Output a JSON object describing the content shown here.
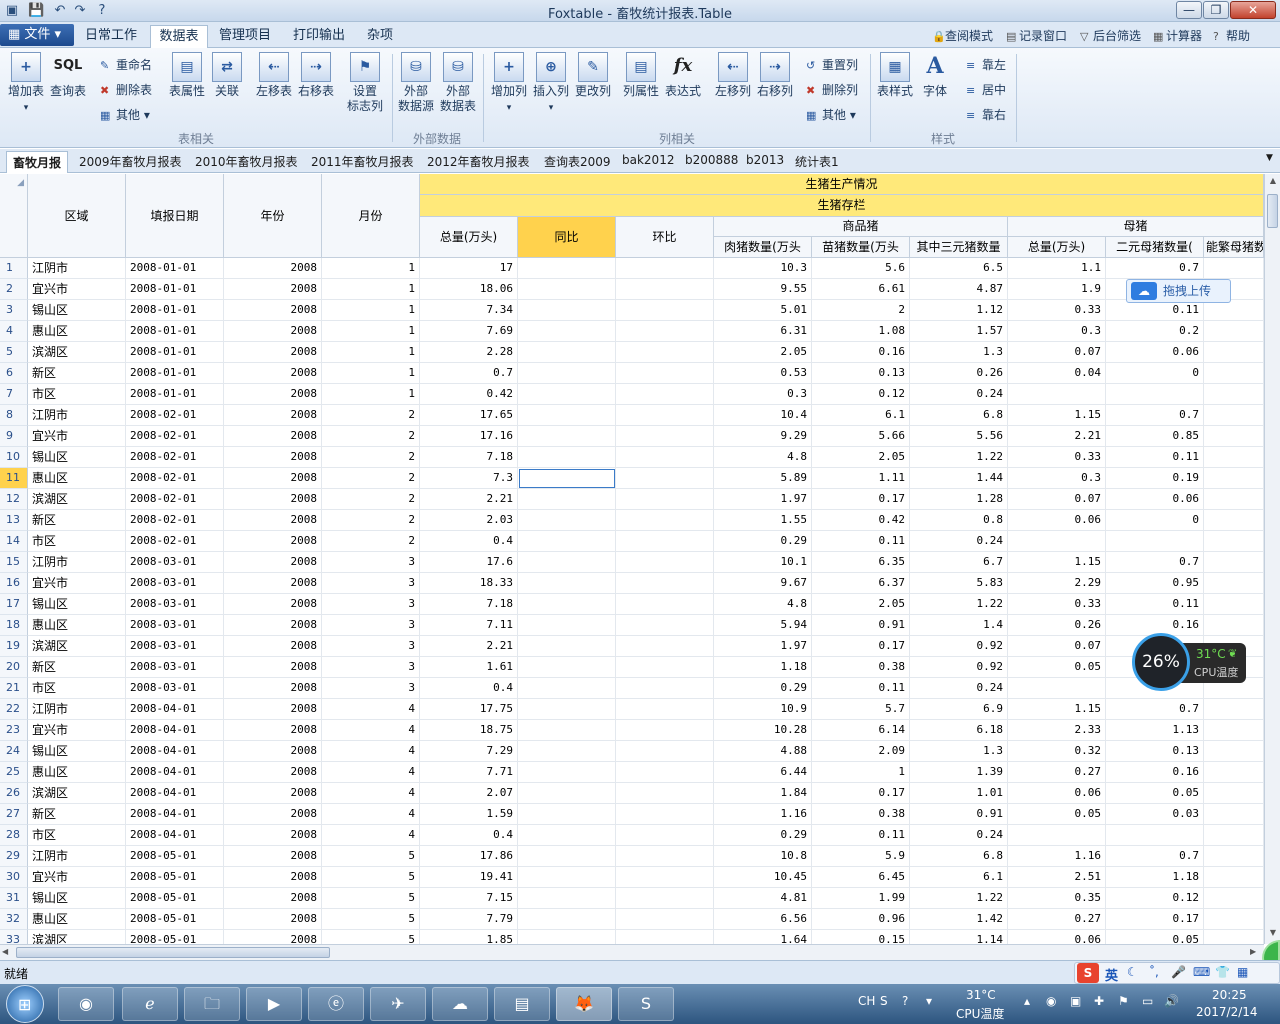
{
  "window": {
    "title": "Foxtable - 畜牧统计报表.Table",
    "min_label": "—",
    "max_label": "❐",
    "close_label": "✕"
  },
  "menu": {
    "file_label": "▦ 文件 ▾",
    "tabs": [
      "日常工作",
      "数据表",
      "管理项目",
      "打印输出",
      "杂项"
    ],
    "right_tools": [
      "查阅模式",
      "记录窗口",
      "后台筛选",
      "计算器",
      "帮助"
    ]
  },
  "ribbon": {
    "table_group": {
      "label": "表相关",
      "add_table": "增加表",
      "query_table": "查询表",
      "rename": "重命名",
      "delete_table": "删除表",
      "other": "其他",
      "table_props": "表属性",
      "relation": "关联",
      "move_left": "左移表",
      "move_right": "右移表",
      "set_flag_col_1": "设置",
      "set_flag_col_2": "标志列"
    },
    "external_group": {
      "label": "外部数据",
      "ext_source_1": "外部",
      "ext_source_2": "数据源",
      "ext_table_1": "外部",
      "ext_table_2": "数据表"
    },
    "column_group": {
      "label": "列相关",
      "add_col": "增加列",
      "insert_col": "插入列",
      "change_col": "更改列",
      "col_props": "列属性",
      "expression": "表达式",
      "col_left": "左移列",
      "col_right": "右移列",
      "reset_cols": "重置列",
      "delete_col": "删除列",
      "other": "其他"
    },
    "style_group": {
      "label": "样式",
      "table_style": "表样式",
      "font": "字体",
      "align_left": "靠左",
      "align_center": "居中",
      "align_right": "靠右"
    }
  },
  "sheet_tabs": [
    "畜牧月报",
    "2009年畜牧月报表",
    "2010年畜牧月报表",
    "2011年畜牧月报表",
    "2012年畜牧月报表",
    "查询表2009",
    "bak2012",
    "b200888",
    "b2013",
    "统计表1"
  ],
  "grid_headers": {
    "region": "区域",
    "report_date": "填报日期",
    "year": "年份",
    "month": "月份",
    "band1": "生猪生产情况",
    "band2": "生猪存栏",
    "total": "总量(万头)",
    "yoy": "同比",
    "mom": "环比",
    "commodity_pig": "商品猪",
    "meat_pig": "肉猪数量(万头",
    "piglet": "苗猪数量(万头",
    "three_cross": "其中三元猪数量",
    "sow": "母猪",
    "sow_total": "总量(万头)",
    "two_cross_sow": "二元母猪数量(",
    "breeding_sow": "能繁母猪数"
  },
  "rows": [
    [
      "1",
      "江阴市",
      "2008-01-01",
      "2008",
      "1",
      "17",
      "",
      "",
      "10.3",
      "5.6",
      "6.5",
      "1.1",
      "0.7"
    ],
    [
      "2",
      "宜兴市",
      "2008-01-01",
      "2008",
      "1",
      "18.06",
      "",
      "",
      "9.55",
      "6.61",
      "4.87",
      "1.9",
      ""
    ],
    [
      "3",
      "锡山区",
      "2008-01-01",
      "2008",
      "1",
      "7.34",
      "",
      "",
      "5.01",
      "2",
      "1.12",
      "0.33",
      "0.11"
    ],
    [
      "4",
      "惠山区",
      "2008-01-01",
      "2008",
      "1",
      "7.69",
      "",
      "",
      "6.31",
      "1.08",
      "1.57",
      "0.3",
      "0.2"
    ],
    [
      "5",
      "滨湖区",
      "2008-01-01",
      "2008",
      "1",
      "2.28",
      "",
      "",
      "2.05",
      "0.16",
      "1.3",
      "0.07",
      "0.06"
    ],
    [
      "6",
      "新区",
      "2008-01-01",
      "2008",
      "1",
      "0.7",
      "",
      "",
      "0.53",
      "0.13",
      "0.26",
      "0.04",
      "0"
    ],
    [
      "7",
      "市区",
      "2008-01-01",
      "2008",
      "1",
      "0.42",
      "",
      "",
      "0.3",
      "0.12",
      "0.24",
      "",
      ""
    ],
    [
      "8",
      "江阴市",
      "2008-02-01",
      "2008",
      "2",
      "17.65",
      "",
      "",
      "10.4",
      "6.1",
      "6.8",
      "1.15",
      "0.7"
    ],
    [
      "9",
      "宜兴市",
      "2008-02-01",
      "2008",
      "2",
      "17.16",
      "",
      "",
      "9.29",
      "5.66",
      "5.56",
      "2.21",
      "0.85"
    ],
    [
      "10",
      "锡山区",
      "2008-02-01",
      "2008",
      "2",
      "7.18",
      "",
      "",
      "4.8",
      "2.05",
      "1.22",
      "0.33",
      "0.11"
    ],
    [
      "11",
      "惠山区",
      "2008-02-01",
      "2008",
      "2",
      "7.3",
      "",
      "",
      "5.89",
      "1.11",
      "1.44",
      "0.3",
      "0.19"
    ],
    [
      "12",
      "滨湖区",
      "2008-02-01",
      "2008",
      "2",
      "2.21",
      "",
      "",
      "1.97",
      "0.17",
      "1.28",
      "0.07",
      "0.06"
    ],
    [
      "13",
      "新区",
      "2008-02-01",
      "2008",
      "2",
      "2.03",
      "",
      "",
      "1.55",
      "0.42",
      "0.8",
      "0.06",
      "0"
    ],
    [
      "14",
      "市区",
      "2008-02-01",
      "2008",
      "2",
      "0.4",
      "",
      "",
      "0.29",
      "0.11",
      "0.24",
      "",
      ""
    ],
    [
      "15",
      "江阴市",
      "2008-03-01",
      "2008",
      "3",
      "17.6",
      "",
      "",
      "10.1",
      "6.35",
      "6.7",
      "1.15",
      "0.7"
    ],
    [
      "16",
      "宜兴市",
      "2008-03-01",
      "2008",
      "3",
      "18.33",
      "",
      "",
      "9.67",
      "6.37",
      "5.83",
      "2.29",
      "0.95"
    ],
    [
      "17",
      "锡山区",
      "2008-03-01",
      "2008",
      "3",
      "7.18",
      "",
      "",
      "4.8",
      "2.05",
      "1.22",
      "0.33",
      "0.11"
    ],
    [
      "18",
      "惠山区",
      "2008-03-01",
      "2008",
      "3",
      "7.11",
      "",
      "",
      "5.94",
      "0.91",
      "1.4",
      "0.26",
      "0.16"
    ],
    [
      "19",
      "滨湖区",
      "2008-03-01",
      "2008",
      "3",
      "2.21",
      "",
      "",
      "1.97",
      "0.17",
      "0.92",
      "0.07",
      ""
    ],
    [
      "20",
      "新区",
      "2008-03-01",
      "2008",
      "3",
      "1.61",
      "",
      "",
      "1.18",
      "0.38",
      "0.92",
      "0.05",
      ""
    ],
    [
      "21",
      "市区",
      "2008-03-01",
      "2008",
      "3",
      "0.4",
      "",
      "",
      "0.29",
      "0.11",
      "0.24",
      "",
      ""
    ],
    [
      "22",
      "江阴市",
      "2008-04-01",
      "2008",
      "4",
      "17.75",
      "",
      "",
      "10.9",
      "5.7",
      "6.9",
      "1.15",
      "0.7"
    ],
    [
      "23",
      "宜兴市",
      "2008-04-01",
      "2008",
      "4",
      "18.75",
      "",
      "",
      "10.28",
      "6.14",
      "6.18",
      "2.33",
      "1.13"
    ],
    [
      "24",
      "锡山区",
      "2008-04-01",
      "2008",
      "4",
      "7.29",
      "",
      "",
      "4.88",
      "2.09",
      "1.3",
      "0.32",
      "0.13"
    ],
    [
      "25",
      "惠山区",
      "2008-04-01",
      "2008",
      "4",
      "7.71",
      "",
      "",
      "6.44",
      "1",
      "1.39",
      "0.27",
      "0.16"
    ],
    [
      "26",
      "滨湖区",
      "2008-04-01",
      "2008",
      "4",
      "2.07",
      "",
      "",
      "1.84",
      "0.17",
      "1.01",
      "0.06",
      "0.05"
    ],
    [
      "27",
      "新区",
      "2008-04-01",
      "2008",
      "4",
      "1.59",
      "",
      "",
      "1.16",
      "0.38",
      "0.91",
      "0.05",
      "0.03"
    ],
    [
      "28",
      "市区",
      "2008-04-01",
      "2008",
      "4",
      "0.4",
      "",
      "",
      "0.29",
      "0.11",
      "0.24",
      "",
      ""
    ],
    [
      "29",
      "江阴市",
      "2008-05-01",
      "2008",
      "5",
      "17.86",
      "",
      "",
      "10.8",
      "5.9",
      "6.8",
      "1.16",
      "0.7"
    ],
    [
      "30",
      "宜兴市",
      "2008-05-01",
      "2008",
      "5",
      "19.41",
      "",
      "",
      "10.45",
      "6.45",
      "6.1",
      "2.51",
      "1.18"
    ],
    [
      "31",
      "锡山区",
      "2008-05-01",
      "2008",
      "5",
      "7.15",
      "",
      "",
      "4.81",
      "1.99",
      "1.22",
      "0.35",
      "0.12"
    ],
    [
      "32",
      "惠山区",
      "2008-05-01",
      "2008",
      "5",
      "7.79",
      "",
      "",
      "6.56",
      "0.96",
      "1.42",
      "0.27",
      "0.17"
    ],
    [
      "33",
      "滨湖区",
      "2008-05-01",
      "2008",
      "5",
      "1.85",
      "",
      "",
      "1.64",
      "0.15",
      "1.14",
      "0.06",
      "0.05"
    ]
  ],
  "overlay": {
    "upload_label": "拖拽上传",
    "cpu_percent": "26%",
    "cpu_temp": "31°C",
    "cpu_label": "CPU温度"
  },
  "status": {
    "text": "就绪",
    "ime_label": "英"
  },
  "taskbar": {
    "tray_lang": "CH",
    "tray_temp": "31°C",
    "tray_temp_label": "CPU温度",
    "time": "20:25",
    "date": "2017/2/14"
  },
  "colors": {
    "band_yellow": "#ffe97a",
    "selected_header": "#ffd24d",
    "ribbon_blue": "#dde8f5"
  }
}
